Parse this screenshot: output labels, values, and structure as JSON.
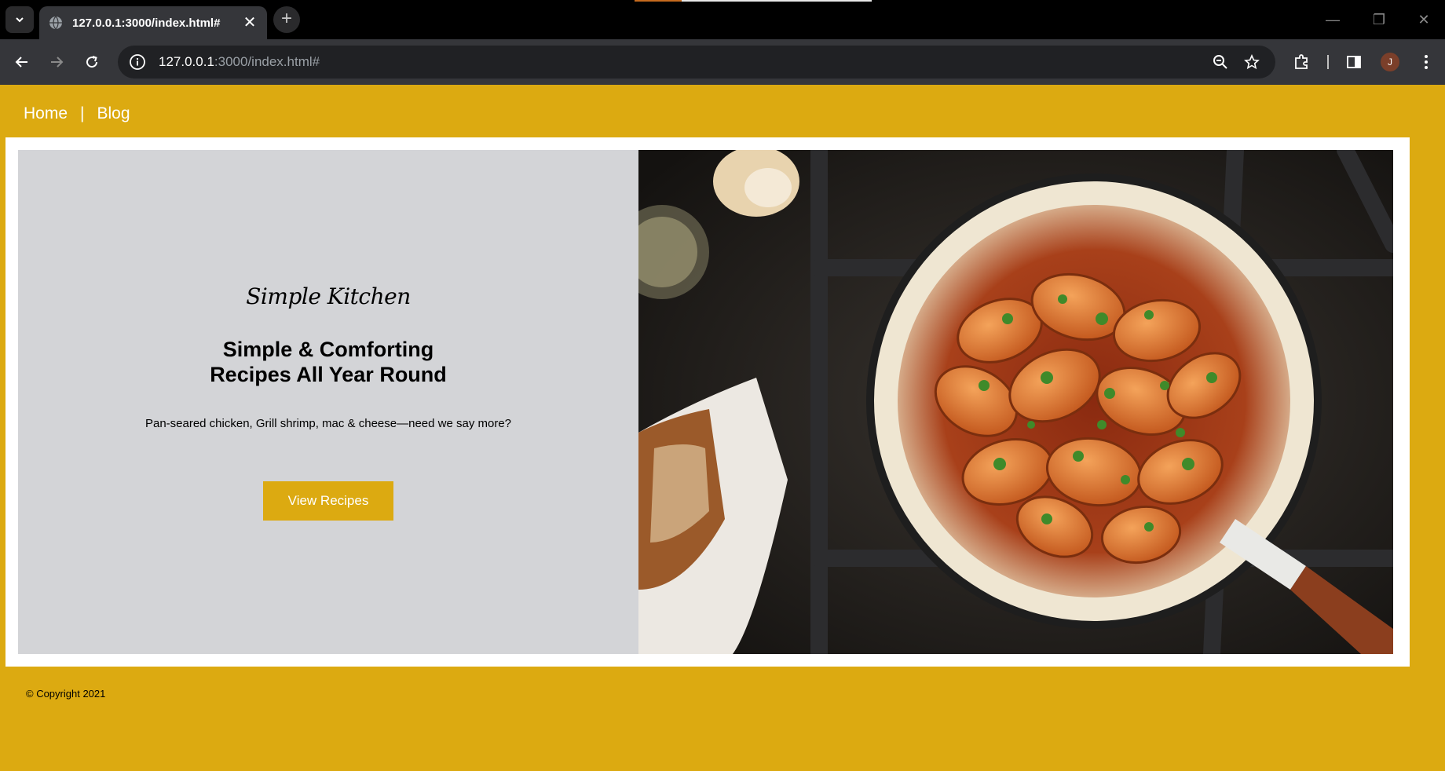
{
  "browser": {
    "tab_title": "127.0.0.1:3000/index.html#",
    "url_host": "127.0.0.1",
    "url_rest": ":3000/index.html#",
    "avatar_initial": "J"
  },
  "nav": {
    "home": "Home",
    "divider": "|",
    "blog": "Blog"
  },
  "hero": {
    "logo_text": "Simple Kitchen",
    "headline_line1": "Simple & Comforting",
    "headline_line2": "Recipes All Year Round",
    "subtext": "Pan-seared chicken, Grill shrimp, mac & cheese—need we say more?",
    "button_label": "View Recipes",
    "image_subject": "shrimp-skillet-photo"
  },
  "footer": {
    "copyright": "© Copyright 2021"
  },
  "colors": {
    "accent": "#dcaa11",
    "hero_panel": "#d3d4d7",
    "browser_dark": "#35363a"
  }
}
